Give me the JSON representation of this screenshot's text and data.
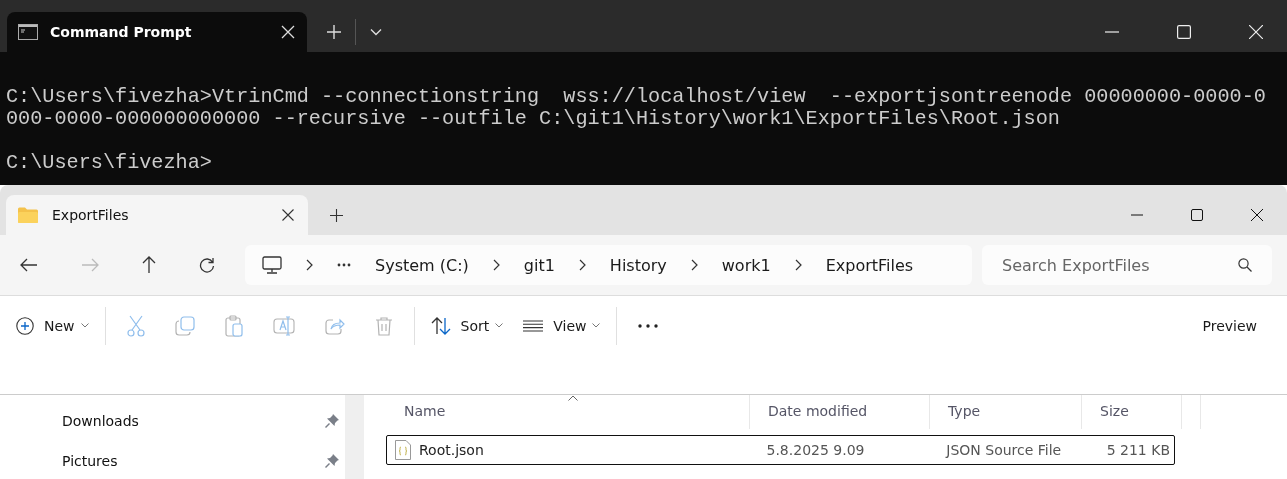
{
  "terminal": {
    "tabs": [
      {
        "title": "Command Prompt",
        "selected": true
      }
    ],
    "blocks": [
      [
        "C:\\Users\\fivezha>VtrinCmd --connectionstring  wss://localhost/view  --exportjsontreenode 00000000-0000-0",
        "000-0000-000000000000 --recursive --outfile C:\\git1\\History\\work1\\ExportFiles\\Root.json"
      ],
      [
        "C:\\Users\\fivezha>"
      ]
    ]
  },
  "explorer": {
    "tabs": [
      {
        "title": "ExportFiles",
        "selected": true
      }
    ],
    "breadcrumb": [
      "System (C:)",
      "git1",
      "History",
      "work1",
      "ExportFiles"
    ],
    "search": {
      "placeholder": "Search ExportFiles"
    },
    "toolbar": [
      {
        "kind": "new",
        "label": "New",
        "disabled": false
      },
      {
        "kind": "cut",
        "disabled": true
      },
      {
        "kind": "copy",
        "disabled": true
      },
      {
        "kind": "paste",
        "disabled": true
      },
      {
        "kind": "rename",
        "disabled": true
      },
      {
        "kind": "share",
        "disabled": true
      },
      {
        "kind": "delete",
        "disabled": true
      },
      {
        "kind": "sort",
        "label": "Sort",
        "disabled": false
      },
      {
        "kind": "view",
        "label": "View",
        "disabled": false
      },
      {
        "kind": "more",
        "disabled": false
      }
    ],
    "preview": "Preview",
    "sidebar": [
      {
        "label": "Downloads",
        "pinned": true
      },
      {
        "label": "Pictures",
        "pinned": true
      }
    ],
    "columns": [
      {
        "label": "Name",
        "sorted": true
      },
      {
        "label": "Date modified",
        "sorted": false
      },
      {
        "label": "Type",
        "sorted": false
      },
      {
        "label": "Size",
        "sorted": false
      }
    ],
    "rows": [
      {
        "name": "Root.json",
        "date": "5.8.2025 9.09",
        "type": "JSON Source File",
        "size": "5 211 KB",
        "selected": true
      }
    ]
  }
}
